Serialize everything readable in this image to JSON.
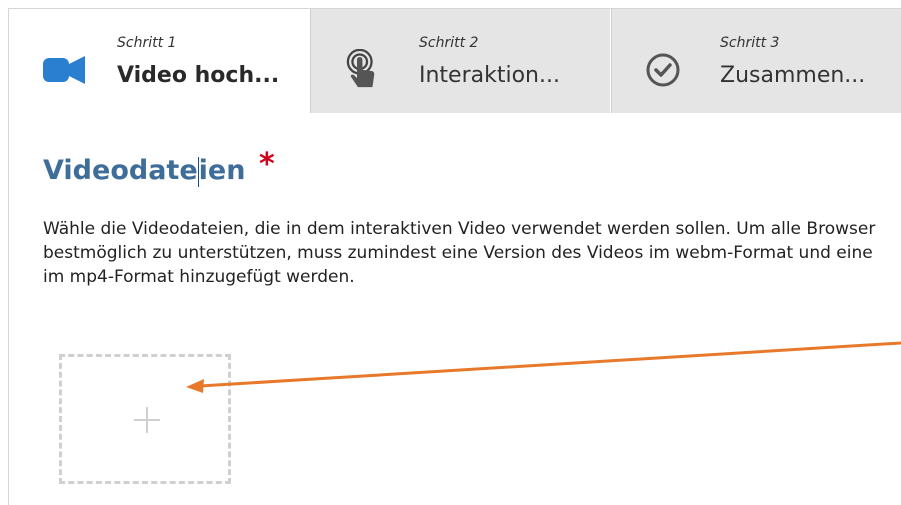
{
  "tabs": [
    {
      "step": "Schritt 1",
      "name": "Video hoch...",
      "icon": "video-camera-icon",
      "active": true
    },
    {
      "step": "Schritt 2",
      "name": "Interaktion...",
      "icon": "touch-pointer-icon",
      "active": false
    },
    {
      "step": "Schritt 3",
      "name": "Zusammen...",
      "icon": "check-circle-icon",
      "active": false
    }
  ],
  "section": {
    "title_part1": "Videodate",
    "title_part2": "ien",
    "required_mark": "*",
    "description": "Wähle die Videodateien, die in dem interaktiven Video verwendet werden sollen. Um alle Browser bestmöglich zu unterstützen, muss zumindest eine Version des Videos im webm-Format und eine im mp4-Format hinzugefügt werden."
  },
  "add_button": {
    "icon": "plus-icon"
  },
  "annotation": {
    "icon": "arrow-icon",
    "color": "#e8792b"
  },
  "colors": {
    "accent": "#2a7fd0",
    "heading": "#3f6d9a",
    "required": "#d0021b",
    "tab_inactive_bg": "#e5e5e5"
  }
}
